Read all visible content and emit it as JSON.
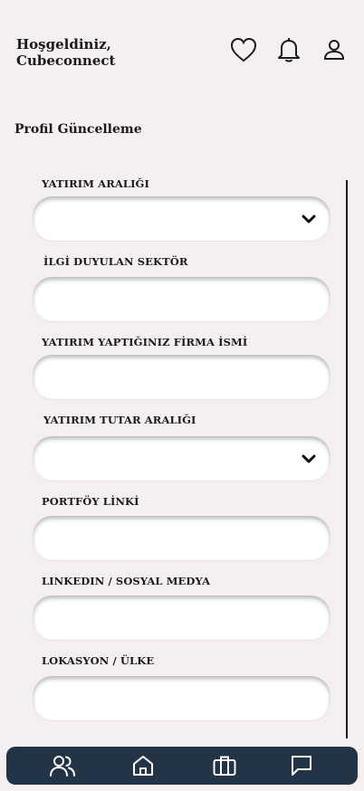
{
  "header": {
    "greeting_line1": "Hoşgeldiniz,",
    "greeting_line2": "Cubeconnect",
    "icons": [
      "heart-icon",
      "bell-icon",
      "user-icon"
    ]
  },
  "page": {
    "title": "Profil Güncelleme"
  },
  "form": {
    "fields": [
      {
        "label": "YATIRIM ARALIĞI",
        "type": "select",
        "value": ""
      },
      {
        "label": "İLGİ DUYULAN SEKTÖR",
        "type": "text",
        "value": ""
      },
      {
        "label": "YATIRIM YAPTIĞINIZ FİRMA İSMİ",
        "type": "text",
        "value": ""
      },
      {
        "label": "YATIRIM TUTAR ARALIĞI",
        "type": "select",
        "value": ""
      },
      {
        "label": "PORTFÖY LİNKİ",
        "type": "text",
        "value": ""
      },
      {
        "label": "LINKEDIN / SOSYAL MEDYA",
        "type": "text",
        "value": ""
      },
      {
        "label": "LOKASYON / ÜLKE",
        "type": "text",
        "value": ""
      }
    ]
  },
  "bottom_nav": {
    "background": "#243447",
    "items": [
      "users-icon",
      "home-icon",
      "briefcase-icon",
      "chat-icon"
    ]
  }
}
